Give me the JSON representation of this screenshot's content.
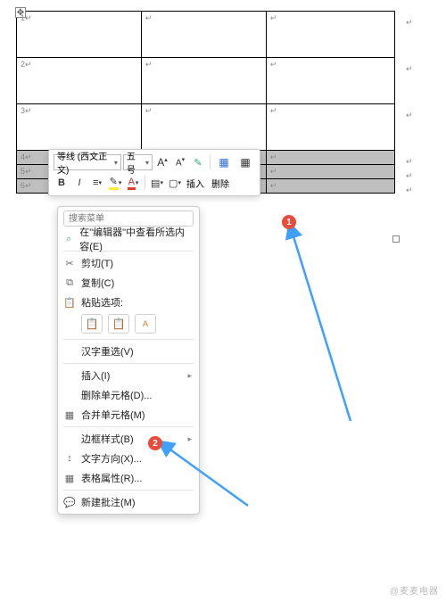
{
  "table": {
    "rows": [
      "1",
      "2",
      "3",
      "4",
      "5",
      "6"
    ]
  },
  "toolbar": {
    "font": "等线 (西文正文)",
    "size": "五号",
    "increase": "A",
    "decrease": "A",
    "format_painter": "格式刷",
    "bold": "B",
    "italic": "I",
    "insert_label": "插入",
    "delete_label": "删除"
  },
  "menu": {
    "search_placeholder": "搜索菜单",
    "lookup": "在\"编辑器\"中查看所选内容(E)",
    "cut": "剪切(T)",
    "copy": "复制(C)",
    "paste_label": "粘贴选项:",
    "hanzi": "汉字重选(V)",
    "insert": "插入(I)",
    "delete_cells": "删除单元格(D)...",
    "merge_cells": "合并单元格(M)",
    "border_style": "边框样式(B)",
    "text_direction": "文字方向(X)...",
    "table_props": "表格属性(R)...",
    "new_comment": "新建批注(M)"
  },
  "badges": {
    "one": "1",
    "two": "2"
  },
  "watermark": "@麦麦电器"
}
